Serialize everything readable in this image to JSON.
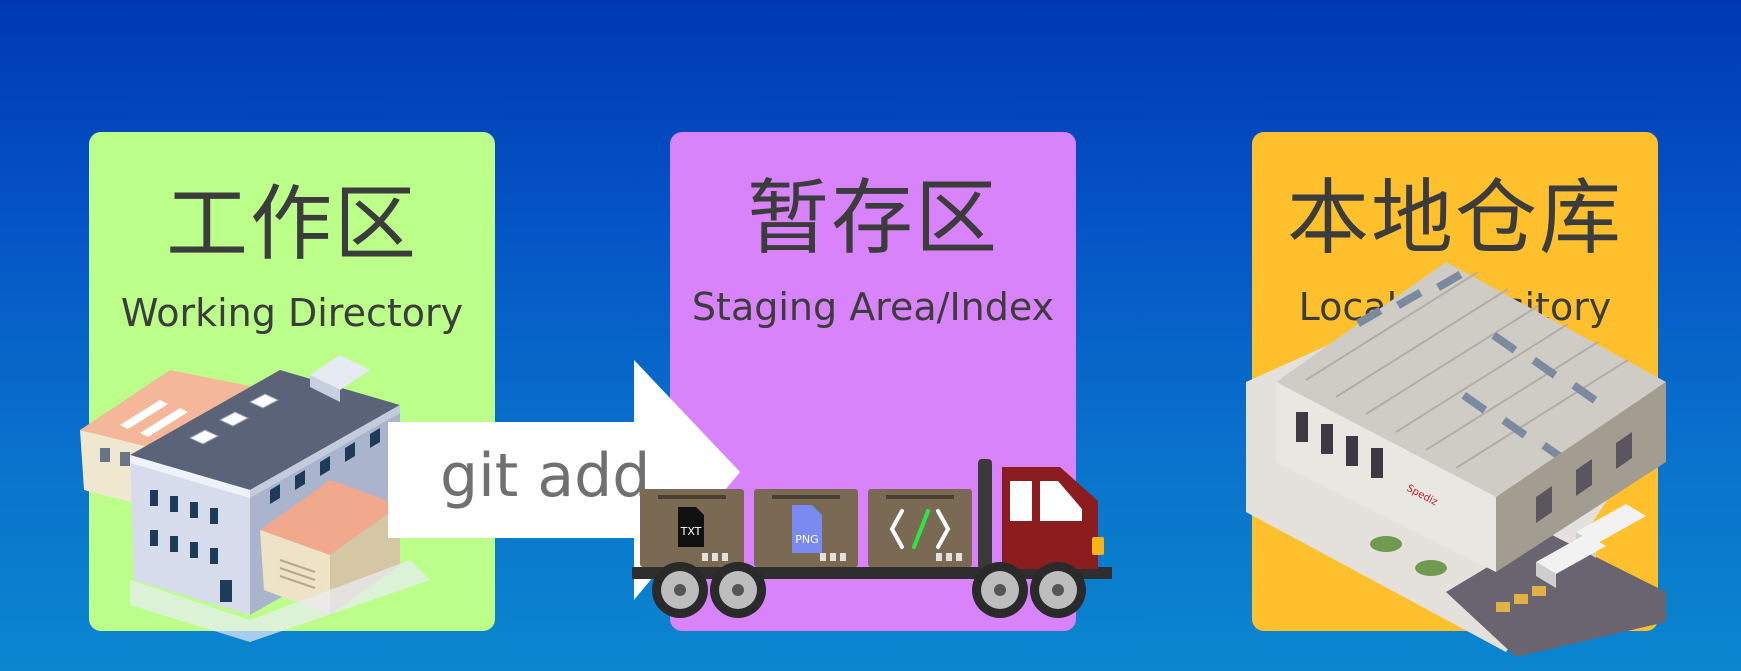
{
  "colors": {
    "working": "#bcfe8a",
    "staging": "#d983fb",
    "local": "#ffc02e"
  },
  "panels": {
    "working": {
      "title_cn": "工作区",
      "title_en": "Working Directory"
    },
    "staging": {
      "title_cn": "暂存区",
      "title_en": "Staging Area/Index"
    },
    "local": {
      "title_cn": "本地仓库",
      "title_en": "Local Repository"
    }
  },
  "arrow": {
    "label": "git add"
  },
  "truck": {
    "boxes": [
      {
        "icon": "txt-file-icon",
        "label": "TXT"
      },
      {
        "icon": "png-file-icon",
        "label": "PNG"
      },
      {
        "icon": "code-brackets-icon",
        "label": ""
      }
    ]
  },
  "icons": [
    "factory-building-icon",
    "truck-icon",
    "warehouse-building-icon",
    "arrow-right-icon"
  ]
}
